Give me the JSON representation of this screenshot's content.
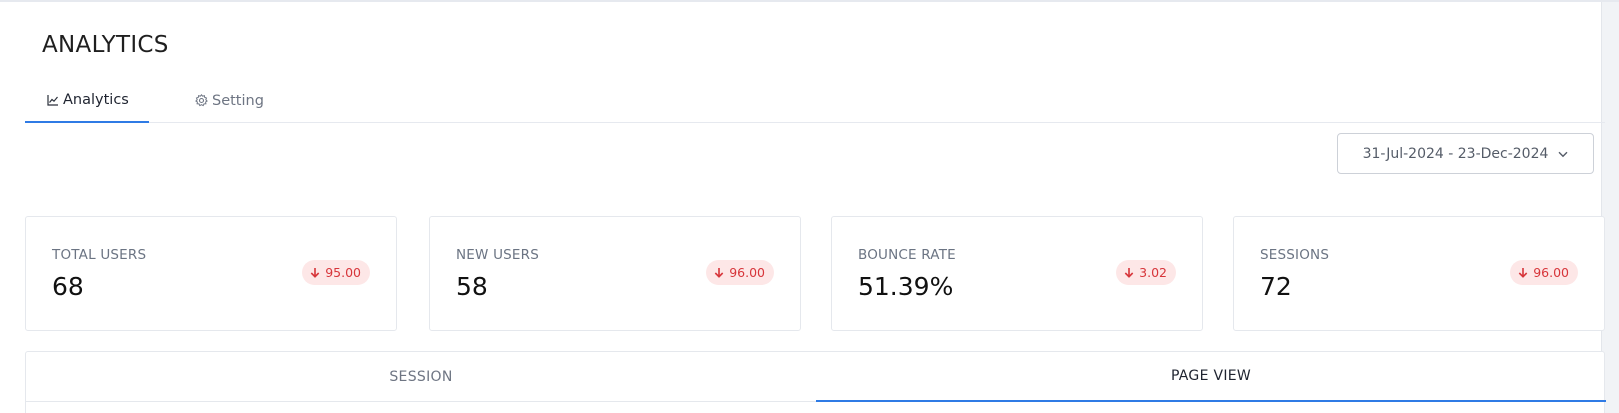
{
  "header": {
    "title": "ANALYTICS"
  },
  "tabs": [
    {
      "label": "Analytics",
      "icon": "chart-line-icon",
      "active": true
    },
    {
      "label": "Setting",
      "icon": "gear-icon",
      "active": false
    }
  ],
  "date_range": {
    "label": "31-Jul-2024 - 23-Dec-2024",
    "icon": "chevron-down-icon"
  },
  "stats": [
    {
      "label": "TOTAL USERS",
      "value": "68",
      "change": "95.00",
      "direction": "down"
    },
    {
      "label": "NEW USERS",
      "value": "58",
      "change": "96.00",
      "direction": "down"
    },
    {
      "label": "BOUNCE RATE",
      "value": "51.39%",
      "change": "3.02",
      "direction": "down"
    },
    {
      "label": "SESSIONS",
      "value": "72",
      "change": "96.00",
      "direction": "down"
    }
  ],
  "panel_tabs": [
    {
      "label": "SESSION",
      "active": false
    },
    {
      "label": "PAGE VIEW",
      "active": true
    }
  ],
  "colors": {
    "accent": "#2f7be5",
    "negative": "#d7353a",
    "negative_bg": "#fde7e7"
  }
}
